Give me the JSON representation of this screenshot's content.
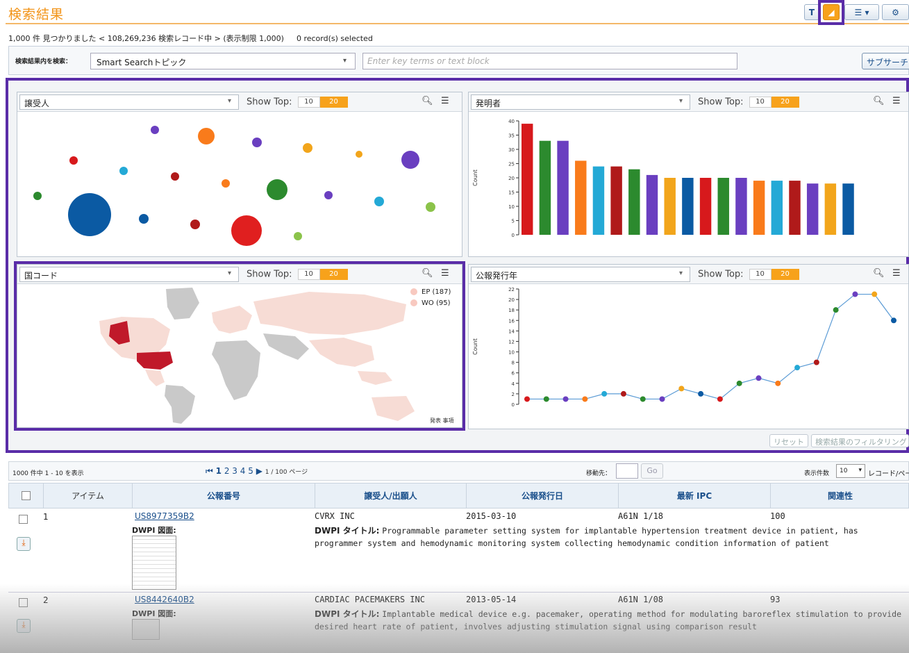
{
  "header": {
    "title": "検索結果",
    "stats": "1,000 件 見つかりました < 108,269,236 検索レコード中 > (表示制限 1,000)",
    "selected": "0 record(s) selected"
  },
  "toolbar": {
    "filter_icon": "filter-icon",
    "chart_icon": "chart-icon",
    "view_icon": "view-icon",
    "settings_icon": "gear-icon",
    "dropdown": "▾"
  },
  "search": {
    "label": "検索結果内を検索：",
    "dropdown_value": "Smart Searchトピック",
    "placeholder": "Enter key terms or text block",
    "button": "サブサーチ"
  },
  "panels": {
    "assignee": {
      "select": "譲受人",
      "show_top": "Show Top:",
      "opt10": "10",
      "opt20": "20"
    },
    "inventor": {
      "select": "発明者",
      "show_top": "Show Top:",
      "opt10": "10",
      "opt20": "20"
    },
    "country": {
      "select": "国コード",
      "show_top": "Show Top:",
      "opt10": "10",
      "opt20": "20",
      "legend": [
        "EP (187)",
        "WO (95)"
      ],
      "caption": "発表 事項"
    },
    "year": {
      "select": "公報発行年",
      "show_top": "Show Top:",
      "opt10": "10",
      "opt20": "20"
    }
  },
  "chart_data": [
    {
      "type": "scatter",
      "note_type": "bubble",
      "series": [
        {
          "values": [
            {
              "color": "#0b5aa3",
              "r": 31
            },
            {
              "color": "#e01f1f",
              "r": 22
            },
            {
              "color": "#2c8a2e",
              "r": 15
            },
            {
              "color": "#6a3fc0",
              "r": 13
            },
            {
              "color": "#f97b1b",
              "r": 12
            },
            {
              "color": "#2c8a2e",
              "r": 6
            },
            {
              "color": "#f2a51b",
              "r": 7
            },
            {
              "color": "#24a9d6",
              "r": 7
            },
            {
              "color": "#b01a1a",
              "r": 7
            }
          ]
        }
      ]
    },
    {
      "type": "bar",
      "ylabel": "Count",
      "ylim": [
        0,
        40
      ],
      "yticks": [
        0,
        5,
        10,
        15,
        20,
        25,
        30,
        35,
        40
      ],
      "values": [
        39,
        33,
        33,
        26,
        24,
        24,
        23,
        21,
        20,
        20,
        20,
        20,
        20,
        19,
        19,
        19,
        18,
        18,
        18
      ],
      "colors": [
        "#d7191c",
        "#2c8a2e",
        "#6a3fc0",
        "#f97b1b",
        "#24a9d6",
        "#b01a1a",
        "#2c8a2e",
        "#6a3fc0",
        "#f2a51b",
        "#0b5aa3",
        "#d7191c",
        "#2c8a2e",
        "#6a3fc0",
        "#f97b1b",
        "#24a9d6",
        "#b01a1a",
        "#6a3fc0",
        "#f2a51b",
        "#0b5aa3"
      ]
    },
    {
      "type": "line",
      "ylabel": "Count",
      "ylim": [
        0,
        22
      ],
      "yticks": [
        0,
        2,
        4,
        6,
        8,
        10,
        12,
        14,
        16,
        18,
        20,
        22
      ],
      "values": [
        1,
        1,
        1,
        1,
        2,
        2,
        1,
        1,
        3,
        2,
        1,
        4,
        5,
        4,
        7,
        8,
        18,
        21,
        21,
        16
      ],
      "colors": [
        "#d7191c",
        "#2c8a2e",
        "#6a3fc0",
        "#f97b1b",
        "#24a9d6",
        "#b01a1a",
        "#2c8a2e",
        "#6a3fc0",
        "#f2a51b",
        "#0b5aa3",
        "#d7191c",
        "#2c8a2e",
        "#6a3fc0",
        "#f97b1b",
        "#24a9d6",
        "#b01a1a",
        "#2c8a2e",
        "#6a3fc0",
        "#f2a51b",
        "#0b5aa3"
      ]
    }
  ],
  "bottom_buttons": {
    "reset": "リセット",
    "filter": "検索結果のフィルタリング"
  },
  "results": {
    "count_text": "1000 件中 1 - 10 を表示",
    "pager_nav_first": "⏮",
    "pages": [
      "1",
      "2",
      "3",
      "4",
      "5"
    ],
    "pager_nav_next": "▶",
    "page_info": "1 / 100 ページ",
    "goto_label": "移動先：",
    "go": "Go",
    "per_page_label": "表示件数",
    "per_page": "10",
    "per_page_suffix": "レコード/ページ",
    "columns": [
      "アイテム",
      "公報番号",
      "譲受人/出願人",
      "公報発行日",
      "最新 IPC",
      "関連性"
    ],
    "rows": [
      {
        "num": "1",
        "patent": "US8977359B2",
        "drawing_label": "DWPI 図面:",
        "assignee": "CVRX INC",
        "date": "2015-03-10",
        "ipc": "A61N 1/18",
        "relevance": "100",
        "title_label": "DWPI タイトル:",
        "title": "Programmable parameter setting system for implantable hypertension treatment device in patient, has programmer system and hemodynamic monitoring system collecting hemodynamic condition information of patient"
      },
      {
        "num": "2",
        "patent": "US8442640B2",
        "drawing_label": "DWPI 図面:",
        "assignee": "CARDIAC PACEMAKERS INC",
        "date": "2013-05-14",
        "ipc": "A61N 1/08",
        "relevance": "93",
        "title_label": "DWPI タイトル:",
        "title": "Implantable medical device e.g. pacemaker, operating method for modulating baroreflex stimulation to provide desired heart rate of patient, involves adjusting stimulation signal using comparison result"
      }
    ]
  }
}
